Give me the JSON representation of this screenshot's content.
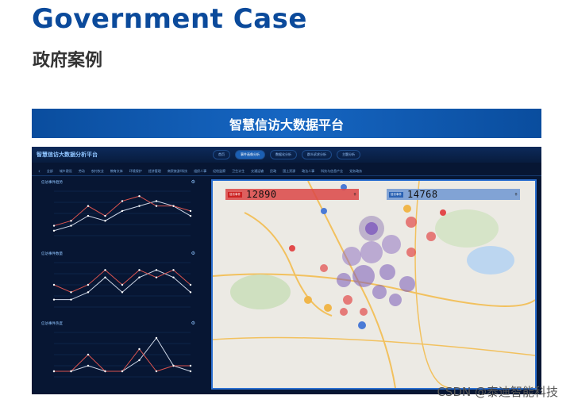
{
  "heading": {
    "en": "Government Case",
    "zh": "政府案例"
  },
  "banner": {
    "title": "智慧信访大数据平台"
  },
  "dashboard": {
    "title": "智慧信访大数据分析平台",
    "top_tabs": [
      "首页",
      "事件画像分析",
      "数据化分析",
      "群众诉求分析",
      "主题分析"
    ],
    "nav_items": [
      "全部",
      "城乡建设",
      "劳动",
      "农村农业",
      "教育文体",
      "环境保护",
      "经济管理",
      "商贸旅游/科技",
      "组织人事",
      "纪检监察",
      "卫生计生",
      "交通运输",
      "民政",
      "国土资源",
      "政法人事",
      "科技与信息产业",
      "党务政务"
    ],
    "panels": [
      {
        "title": "信访事件趋势",
        "series_a": [
          11,
          12,
          15,
          13,
          16,
          17,
          15,
          15,
          14
        ],
        "series_b": [
          10,
          11,
          13,
          12,
          14,
          15,
          16,
          15,
          13
        ]
      },
      {
        "title": "信访事件数量",
        "series_a": [
          13,
          12,
          13,
          15,
          13,
          15,
          14,
          15,
          13
        ],
        "series_b": [
          11,
          11,
          12,
          14,
          12,
          14,
          15,
          14,
          12
        ]
      },
      {
        "title": "信访事件热度",
        "series_a": [
          10,
          10,
          13,
          10,
          10,
          14,
          10,
          11,
          11
        ],
        "series_b": [
          10,
          10,
          11,
          10,
          10,
          12,
          16,
          11,
          10
        ]
      }
    ],
    "map": {
      "stat_left": {
        "label": "信访事件",
        "value": "12890",
        "end": "件"
      },
      "stat_right": {
        "label": "信访事件",
        "value": "14768",
        "end": "件"
      }
    }
  },
  "watermark": "CSDN @泰迪智能科技"
}
